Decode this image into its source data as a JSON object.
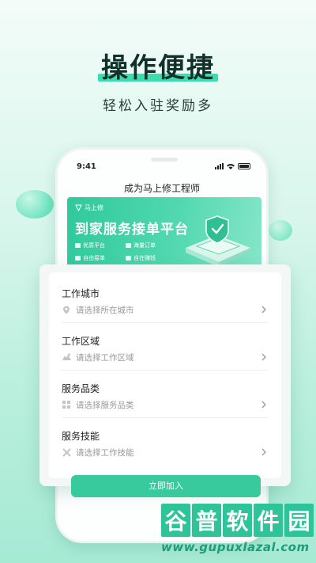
{
  "headline": {
    "title": "操作便捷",
    "subtitle": "轻松入驻奖励多"
  },
  "status_bar": {
    "time": "9:41"
  },
  "app": {
    "title": "成为马上修工程师"
  },
  "banner": {
    "brand": "马上修",
    "title": "到家服务接单平台",
    "features": [
      "优质平台",
      "海量订单",
      "自由接单",
      "自在赚钱"
    ]
  },
  "form": {
    "fields": [
      {
        "label": "工作城市",
        "placeholder": "请选择所在城市",
        "icon": "location-icon"
      },
      {
        "label": "工作区域",
        "placeholder": "请选择工作区域",
        "icon": "map-icon"
      },
      {
        "label": "服务品类",
        "placeholder": "请选择服务品类",
        "icon": "grid-icon"
      },
      {
        "label": "服务技能",
        "placeholder": "请选择工作技能",
        "icon": "tools-icon"
      }
    ]
  },
  "join_button": "立即加入",
  "watermark": {
    "chars": [
      "谷",
      "普",
      "软",
      "件",
      "园"
    ],
    "url": "www.gupuxlazal.com"
  },
  "colors": {
    "accent": "#38c99c",
    "headline_highlight": "#3ddbb0",
    "banner": "#2fc99c"
  }
}
